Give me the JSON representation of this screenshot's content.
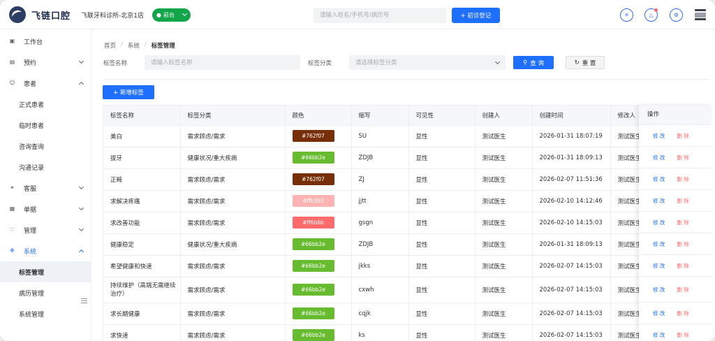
{
  "header": {
    "logo_text": "飞链口腔",
    "clinic": "飞联牙科诊所-北京1店",
    "role": "前台",
    "search_placeholder": "请输入姓名/手机号/病历号",
    "register_button": "+ 初诊登记"
  },
  "sidebar": {
    "items": [
      {
        "label": "工作台",
        "icon": "desktop-icon"
      },
      {
        "label": "预约",
        "icon": "calendar-icon"
      },
      {
        "label": "患者",
        "icon": "user-icon"
      },
      {
        "label": "正式患者"
      },
      {
        "label": "临时患者"
      },
      {
        "label": "咨询查询"
      },
      {
        "label": "沟通记录"
      },
      {
        "label": "客服",
        "icon": "headset-icon"
      },
      {
        "label": "单据",
        "icon": "receipt-icon"
      },
      {
        "label": "管理",
        "icon": "grid-icon"
      },
      {
        "label": "系统",
        "icon": "gear-icon"
      },
      {
        "label": "标签管理"
      },
      {
        "label": "病历管理"
      },
      {
        "label": "系统管理"
      }
    ]
  },
  "breadcrumb": {
    "home": "首页",
    "section": "系统",
    "current": "标签管理"
  },
  "filters": {
    "name_label": "标签名称",
    "name_placeholder": "请输入标签名称",
    "category_label": "标签分类",
    "category_placeholder": "请选择标签分类",
    "query_button": "查 询",
    "reset_button": "重 置"
  },
  "add_button": "+ 新增标签",
  "table": {
    "columns": [
      "标签名称",
      "标签分类",
      "颜色",
      "缩写",
      "可见性",
      "创建人",
      "创建时间",
      "修改人",
      "操作"
    ],
    "edit_label": "修 改",
    "delete_label": "删 除",
    "rows": [
      {
        "name": "美白",
        "category": "需求顾虑/需求",
        "color": "#762f07",
        "abbr": "SU",
        "visibility": "显性",
        "creator": "测试医生",
        "created": "2026-01-31 18:07:19",
        "modifier": "测试医生"
      },
      {
        "name": "拔牙",
        "category": "健康状况/重大疾病",
        "color": "#66bb2e",
        "abbr": "ZDJB",
        "visibility": "显性",
        "creator": "测试医生",
        "created": "2026-01-31 18:09:13",
        "modifier": "测试医生"
      },
      {
        "name": "正畸",
        "category": "需求顾虑/需求",
        "color": "#762f07",
        "abbr": "ZJ",
        "visibility": "显性",
        "creator": "测试医生",
        "created": "2026-02-07 11:51:36",
        "modifier": "测试医生"
      },
      {
        "name": "求解决疼痛",
        "category": "需求顾虑/需求",
        "color": "#ffb3b3",
        "abbr": "jjtt",
        "visibility": "显性",
        "creator": "测试医生",
        "created": "2026-02-10 14:12:46",
        "modifier": "测试医生"
      },
      {
        "name": "求改善功能",
        "category": "需求顾虑/需求",
        "color": "#ff6b6b",
        "abbr": "gsgn",
        "visibility": "显性",
        "creator": "测试医生",
        "created": "2026-02-10 14:15:03",
        "modifier": "测试医生"
      },
      {
        "name": "健康稳定",
        "category": "健康状况/重大疾病",
        "color": "#66bb2e",
        "abbr": "ZDJB",
        "visibility": "显性",
        "creator": "测试医生",
        "created": "2026-01-31 18:09:13",
        "modifier": "测试医生"
      },
      {
        "name": "希望健康和快速",
        "category": "需求顾虑/需求",
        "color": "#66bb2e",
        "abbr": "jkks",
        "visibility": "显性",
        "creator": "测试医生",
        "created": "2026-02-07 14:15:03",
        "modifier": "测试医生"
      },
      {
        "name": "持续维护（高端无需继续治疗）",
        "category": "需求顾虑/需求",
        "color": "#66bb2e",
        "abbr": "cxwh",
        "visibility": "显性",
        "creator": "测试医生",
        "created": "2026-02-07 14:15:03",
        "modifier": "测试医生"
      },
      {
        "name": "求长期健康",
        "category": "需求顾虑/需求",
        "color": "#66bb2e",
        "abbr": "cqjk",
        "visibility": "显性",
        "creator": "测试医生",
        "created": "2026-02-07 14:15:03",
        "modifier": "测试医生"
      },
      {
        "name": "求快速",
        "category": "需求顾虑/需求",
        "color": "#66bb2e",
        "abbr": "ks",
        "visibility": "显性",
        "creator": "测试医生",
        "created": "2026-02-07 14:15:03",
        "modifier": "测试医生"
      }
    ]
  },
  "colors": {
    "primary": "#1f6fff",
    "danger": "#f56c6c",
    "role_green": "#13a54a"
  }
}
